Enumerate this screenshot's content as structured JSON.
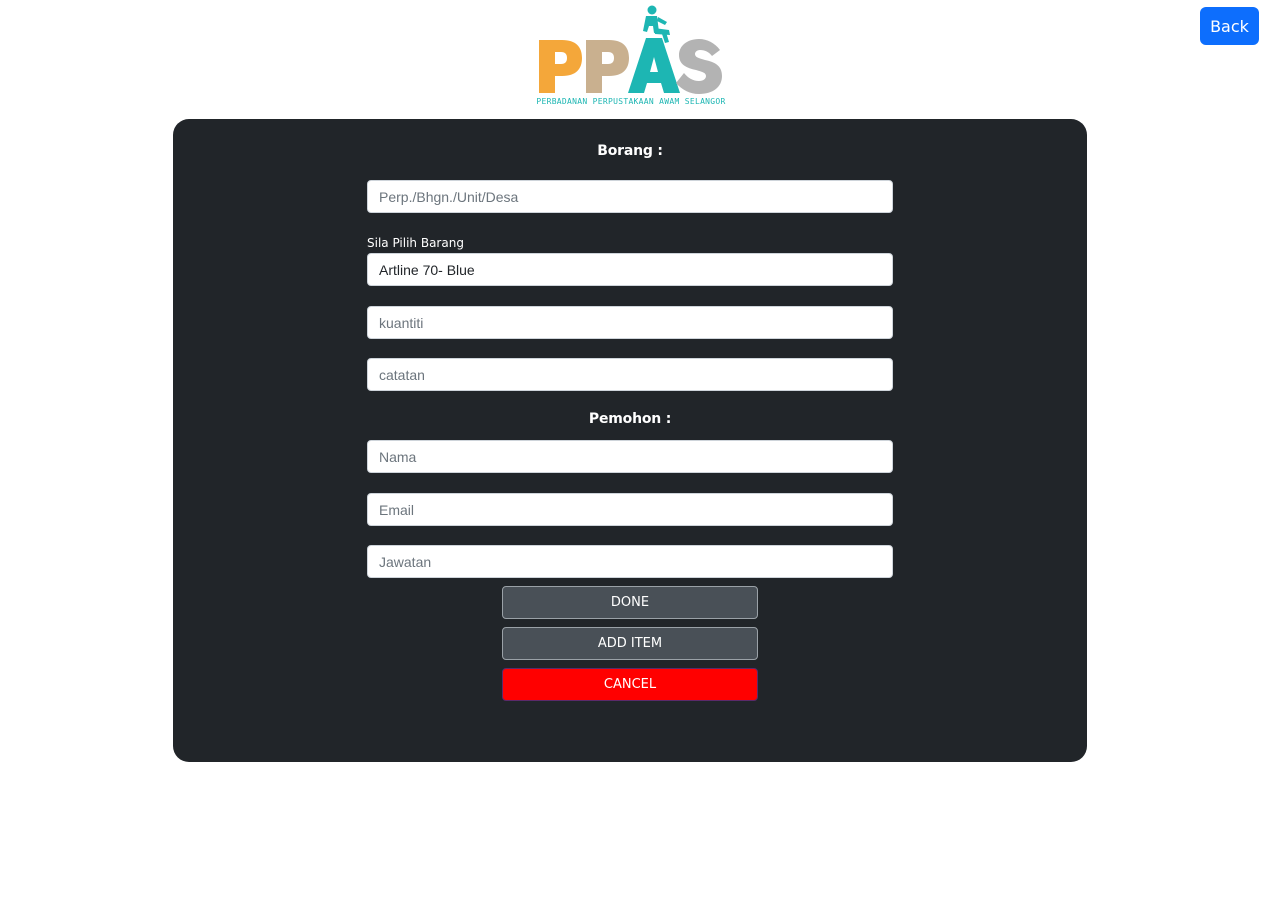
{
  "header": {
    "back_label": "Back",
    "logo": {
      "text": "PPAS",
      "subtitle": "PERBADANAN PERPUSTAKAAN AWAM SELANGOR",
      "colors": {
        "p1": "#f4a73a",
        "p2": "#c9b08f",
        "a": "#1db6b3",
        "s": "#b3b3b3",
        "subtitle": "#1db6b3"
      }
    }
  },
  "form": {
    "borang_heading": "Borang :",
    "department_placeholder": "Perp./Bhgn./Unit/Desa",
    "item_label": "Sila Pilih Barang",
    "item_selected": "Artline 70- Blue",
    "quantity_placeholder": "kuantiti",
    "notes_placeholder": "catatan",
    "pemohon_heading": "Pemohon :",
    "name_placeholder": "Nama",
    "email_placeholder": "Email",
    "position_placeholder": "Jawatan",
    "done_label": "DONE",
    "add_item_label": "ADD ITEM",
    "cancel_label": "CANCEL"
  },
  "colors": {
    "accent": "#0d6efd",
    "card_bg": "#212529",
    "cancel": "#ff0000"
  }
}
